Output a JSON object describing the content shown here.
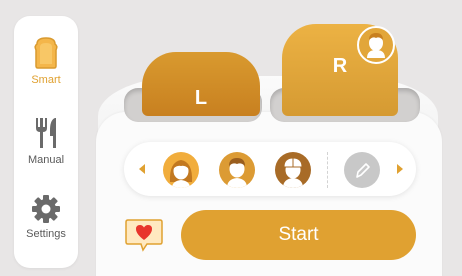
{
  "sidebar": {
    "items": [
      {
        "label": "Smart",
        "icon": "toast-icon",
        "active": true
      },
      {
        "label": "Manual",
        "icon": "cutlery-icon",
        "active": false
      },
      {
        "label": "Settings",
        "icon": "gear-icon",
        "active": false
      }
    ]
  },
  "toaster": {
    "left_slot_label": "L",
    "right_slot_label": "R"
  },
  "profiles": {
    "items": [
      {
        "icon": "woman-avatar-icon"
      },
      {
        "icon": "man-avatar-icon"
      },
      {
        "icon": "cap-avatar-icon"
      },
      {
        "icon": "pencil-icon"
      }
    ]
  },
  "actions": {
    "start_label": "Start",
    "favorite_icon": "heart-chat-icon"
  },
  "colors": {
    "accent": "#e0a131",
    "toast_dark": "#c88020",
    "background": "#e8e6e6"
  }
}
